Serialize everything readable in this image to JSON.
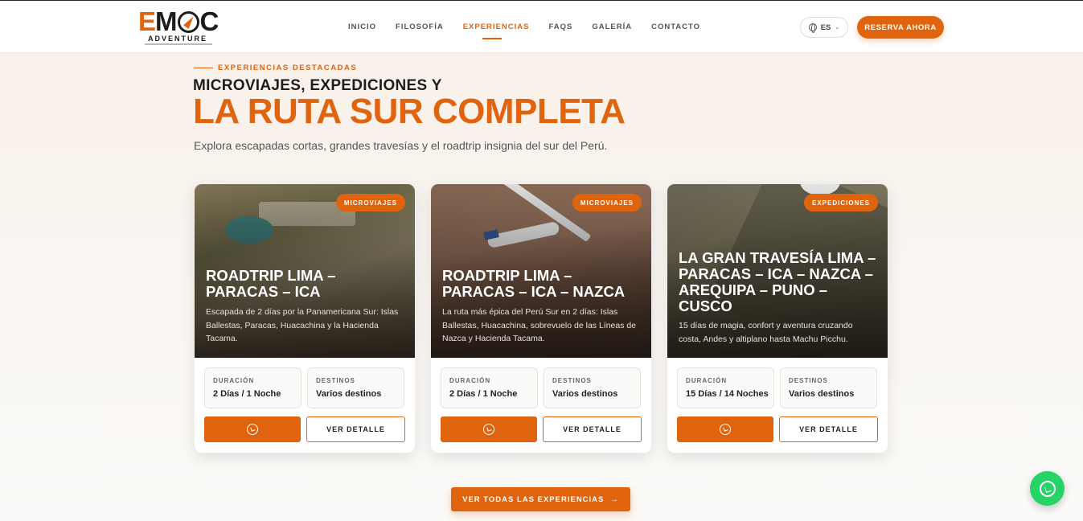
{
  "header": {
    "logo": {
      "main": "EMOC",
      "sub": "ADVENTURE"
    },
    "nav": [
      {
        "label": "INICIO",
        "active": false
      },
      {
        "label": "FILOSOFÍA",
        "active": false
      },
      {
        "label": "EXPERIENCIAS",
        "active": true
      },
      {
        "label": "FAQS",
        "active": false
      },
      {
        "label": "GALERÍA",
        "active": false
      },
      {
        "label": "CONTACTO",
        "active": false
      }
    ],
    "language": "ES",
    "cta_label": "RESERVA AHORA"
  },
  "section": {
    "eyebrow": "EXPERIENCIAS DESTACADAS",
    "title_line1": "MICROVIAJES, EXPEDICIONES Y",
    "title_line2": "LA RUTA SUR COMPLETA",
    "subtitle": "Explora escapadas cortas, grandes travesías y el roadtrip insignia del sur del Perú."
  },
  "cards": [
    {
      "badge": "MICROVIAJES",
      "title": "ROADTRIP LIMA – PARACAS – ICA",
      "description": "Escapada de 2 días por la Panamericana Sur: Islas Ballestas, Paracas, Huacachina y la Hacienda Tacama.",
      "duration_label": "DURACIÓN",
      "duration": "2 Días / 1 Noche",
      "destinations_label": "DESTINOS",
      "destinations": "Varios destinos",
      "detail_label": "VER DETALLE"
    },
    {
      "badge": "MICROVIAJES",
      "title": "ROADTRIP LIMA – PARACAS – ICA – NAZCA",
      "description": "La ruta más épica del Perú Sur en 2 días: Islas Ballestas, Huacachina, sobrevuelo de las Líneas de Nazca y Hacienda Tacama.",
      "duration_label": "DURACIÓN",
      "duration": "2 Días / 1 Noche",
      "destinations_label": "DESTINOS",
      "destinations": "Varios destinos",
      "detail_label": "VER DETALLE"
    },
    {
      "badge": "EXPEDICIONES",
      "title": "LA GRAN TRAVESÍA LIMA – PARACAS – ICA – NAZCA – AREQUIPA – PUNO – CUSCO",
      "description": "15 días de magia, confort y aventura cruzando costa, Andes y altiplano hasta Machu Picchu.",
      "duration_label": "DURACIÓN",
      "duration": "15 Días / 14 Noches",
      "destinations_label": "DESTINOS",
      "destinations": "Varios destinos",
      "detail_label": "VER DETALLE"
    }
  ],
  "footer_cta": {
    "label": "VER TODAS LAS EXPERIENCIAS",
    "arrow": "→"
  },
  "colors": {
    "accent": "#e0630d",
    "whatsapp": "#25d366"
  },
  "icons": [
    "globe-icon",
    "chevron-down-icon",
    "whatsapp-icon",
    "arrow-right-icon"
  ]
}
